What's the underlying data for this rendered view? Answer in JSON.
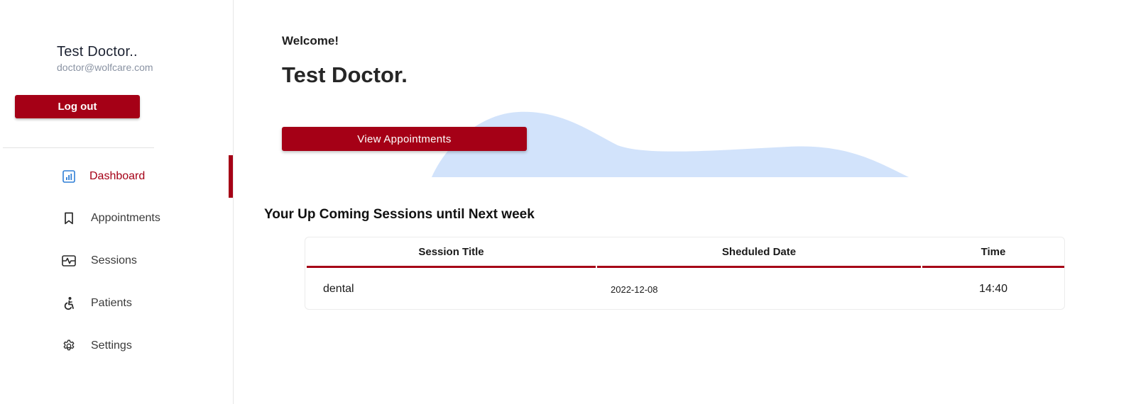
{
  "sidebar": {
    "user_name": "Test Doctor..",
    "user_email": "doctor@wolfcare.com",
    "logout_label": "Log out",
    "items": [
      {
        "label": "Dashboard",
        "icon": "bar-chart-icon",
        "active": true
      },
      {
        "label": "Appointments",
        "icon": "bookmark-icon",
        "active": false
      },
      {
        "label": "Sessions",
        "icon": "activity-icon",
        "active": false
      },
      {
        "label": "Patients",
        "icon": "accessibility-icon",
        "active": false
      },
      {
        "label": "Settings",
        "icon": "gear-icon",
        "active": false
      }
    ]
  },
  "main": {
    "welcome": "Welcome!",
    "doctor_name": "Test Doctor.",
    "view_appointments_label": "View Appointments",
    "sessions_heading": "Your Up Coming Sessions until Next week",
    "table": {
      "headers": [
        "Session Title",
        "Sheduled Date",
        "Time"
      ],
      "rows": [
        {
          "title": "dental",
          "date": "2022-12-08",
          "time": "14:40"
        }
      ]
    }
  },
  "colors": {
    "accent": "#a50016",
    "wave": "#d2e3fb",
    "icon_active": "#2f7fd6"
  }
}
